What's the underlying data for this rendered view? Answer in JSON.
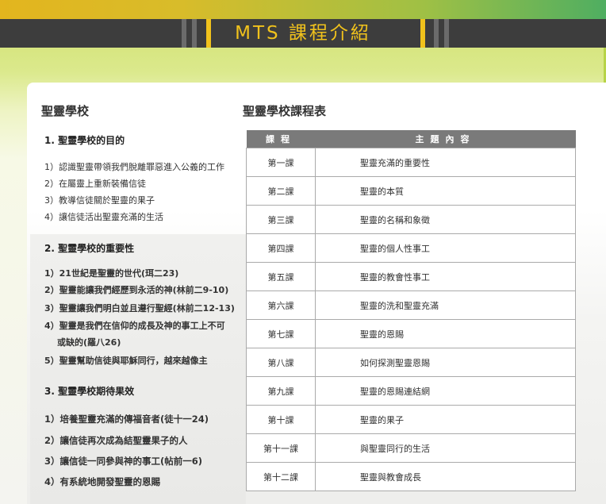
{
  "header": {
    "title": "MTS 課程介紹"
  },
  "left": {
    "heading": "聖靈學校",
    "sections": [
      {
        "title": "1. 聖靈學校的目的",
        "items": [
          "1）認識聖靈帶領我們脫離罪惡進入公義的工作",
          "2）在屬靈上重新裝備信徒",
          "3）教導信徒關於聖靈的果子",
          "4）讓信徒活出聖靈充滿的生活"
        ]
      },
      {
        "title": "2. 聖靈學校的重要性",
        "items": [
          "1）21世紀是聖靈的世代(珥二23)",
          "2）聖靈能讓我們經歷到永活的神(林前二9-10)",
          "3）聖靈讓我們明白並且遵行聖經(林前二12-13)",
          "4）聖靈是我們在信仰的成長及神的事工上不可",
          "或缺的(羅八26)",
          "5）聖靈幫助信徒與耶穌同行，越來越像主"
        ]
      },
      {
        "title": "3. 聖靈學校期待果效",
        "items": [
          "1）培養聖靈充滿的傳福音者(徒十一24)",
          "2）讓信徒再次成為結聖靈果子的人",
          "3）讓信徒一同參與神的事工(帖前一6)",
          "4）有系統地開發聖靈的恩賜"
        ]
      }
    ]
  },
  "right": {
    "heading": "聖靈學校課程表",
    "table": {
      "headers": [
        "課程",
        "主題內容"
      ],
      "rows": [
        [
          "第一課",
          "聖靈充滿的重要性"
        ],
        [
          "第二課",
          "聖靈的本質"
        ],
        [
          "第三課",
          "聖靈的名稱和象徵"
        ],
        [
          "第四課",
          "聖靈的個人性事工"
        ],
        [
          "第五課",
          "聖靈的教會性事工"
        ],
        [
          "第六課",
          "聖靈的洗和聖靈充滿"
        ],
        [
          "第七課",
          "聖靈的恩賜"
        ],
        [
          "第八課",
          "如何探測聖靈恩賜"
        ],
        [
          "第九課",
          "聖靈的恩賜連結網"
        ],
        [
          "第十課",
          "聖靈的果子"
        ],
        [
          "第十一課",
          "與聖靈同行的生活"
        ],
        [
          "第十二課",
          "聖靈與教會成長"
        ]
      ]
    }
  }
}
